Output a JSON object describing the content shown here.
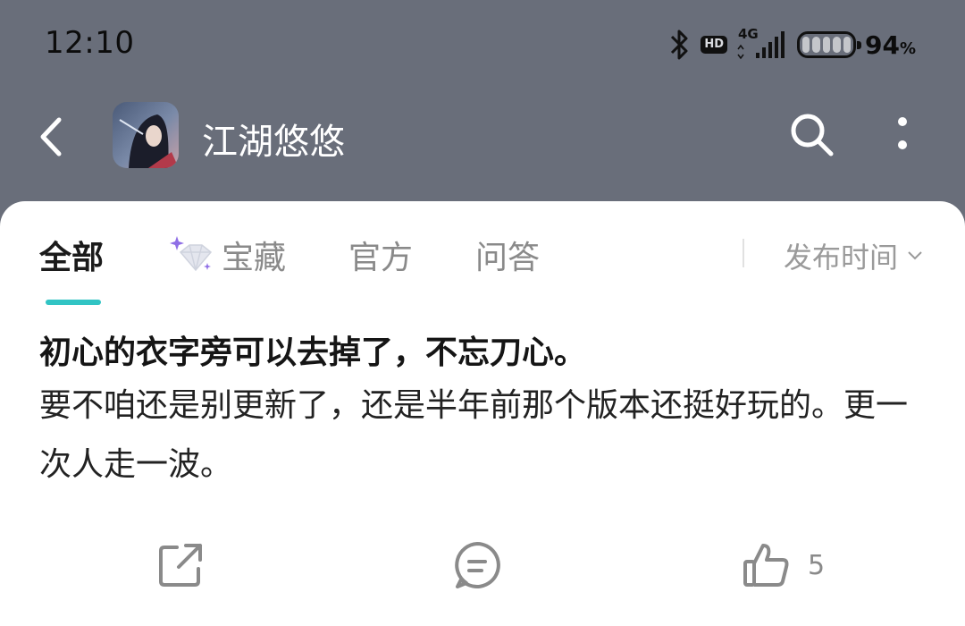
{
  "status_bar": {
    "time": "12:10",
    "hd_label": "HD",
    "network_label": "4G",
    "battery_percent": "94",
    "battery_percent_sign": "%"
  },
  "header": {
    "title": "江湖悠悠",
    "icons": [
      "back-arrow-icon",
      "app-icon",
      "search-icon",
      "more-icon"
    ]
  },
  "tabs": [
    {
      "label": "全部",
      "active": true
    },
    {
      "label": "宝藏",
      "active": false
    },
    {
      "label": "官方",
      "active": false
    },
    {
      "label": "问答",
      "active": false
    }
  ],
  "sort": {
    "label": "发布时间"
  },
  "post": {
    "title": "初心的衣字旁可以去掉了，不忘刀心。",
    "body": "要不咱还是别更新了，还是半年前那个版本还挺好玩的。更一次人走一波。",
    "likes": "5"
  },
  "colors": {
    "background": "#696e7a",
    "accent": "#31c4c4",
    "card": "#ffffff"
  }
}
